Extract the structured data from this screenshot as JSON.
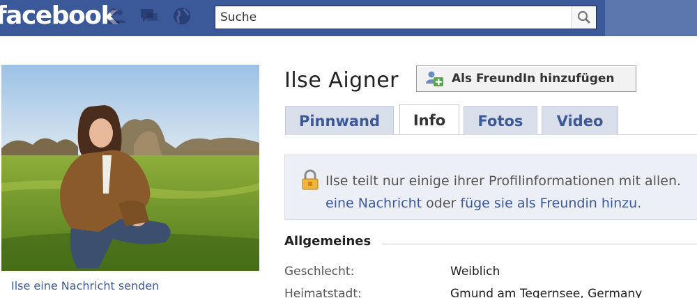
{
  "topbar": {
    "logo": "facebook",
    "icons": [
      "friend-requests-icon",
      "messages-icon",
      "notifications-globe-icon"
    ],
    "search": {
      "value": "Suche"
    }
  },
  "profile": {
    "name": "Ilse Aigner",
    "add_friend_label": "Als FreundIn hinzufügen",
    "send_message_link": "Ilse eine Nachricht senden"
  },
  "tabs": [
    {
      "label": "Pinnwand",
      "active": false
    },
    {
      "label": "Info",
      "active": true
    },
    {
      "label": "Fotos",
      "active": false
    },
    {
      "label": "Video",
      "active": false
    }
  ],
  "notice": {
    "line1": "Ilse teilt nur einige ihrer Profilinformationen mit allen.",
    "link1": "eine Nachricht",
    "middle": " oder ",
    "link2": "füge sie als Freundin hinzu",
    "end": "."
  },
  "info": {
    "section_title": "Allgemeines",
    "rows": [
      {
        "label": "Geschlecht:",
        "value": "Weiblich"
      },
      {
        "label": "Heimatstadt:",
        "value": "Gmund am Tegernsee, Germany"
      }
    ]
  },
  "colors": {
    "brand_blue": "#3b5998",
    "tab_bg": "#d8dfea",
    "notice_bg": "#eceff5"
  }
}
